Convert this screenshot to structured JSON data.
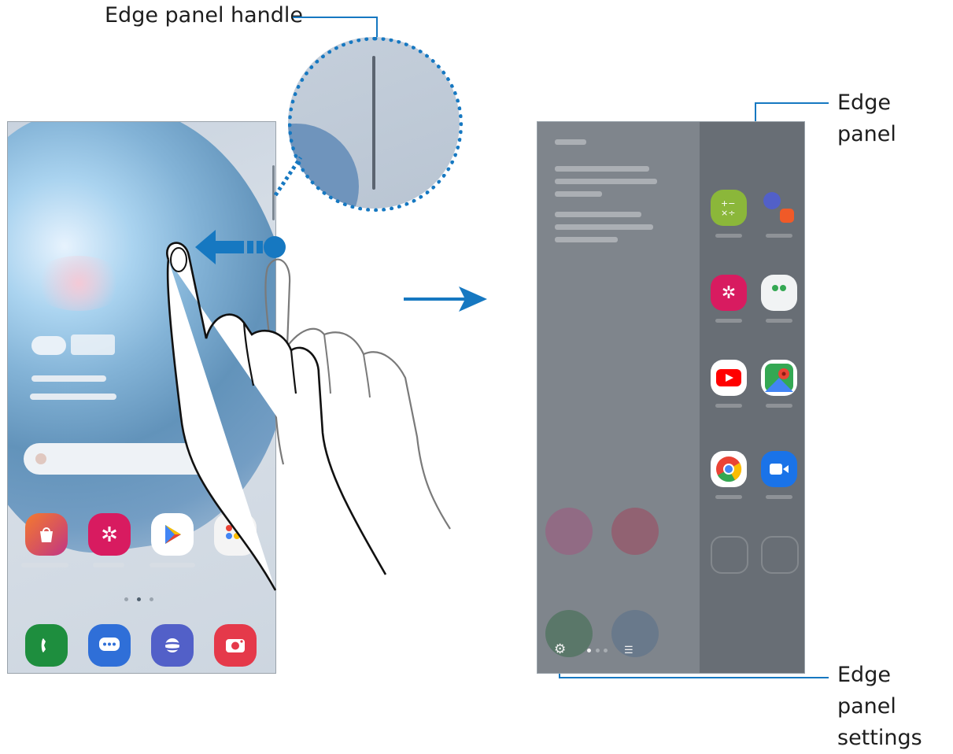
{
  "callouts": {
    "edge_panel_handle": "Edge panel handle",
    "edge_panel": "Edge panel",
    "edge_panel_settings_line1": "Edge panel",
    "edge_panel_settings_line2": "settings"
  },
  "colors": {
    "callout_line": "#1678c1",
    "arrow": "#1678c1"
  },
  "left_phone": {
    "dock_icons": [
      "phone-icon",
      "messages-icon",
      "internet-icon",
      "camera-icon"
    ],
    "home_icons": [
      "galaxy-store-icon",
      "gallery-icon",
      "play-store-icon",
      "google-folder-icon"
    ]
  },
  "right_phone": {
    "edge_apps": [
      "calculator-icon",
      "pair-icon",
      "gallery-icon",
      "folder-icon",
      "youtube-icon",
      "maps-icon",
      "chrome-icon",
      "duo-icon"
    ]
  }
}
